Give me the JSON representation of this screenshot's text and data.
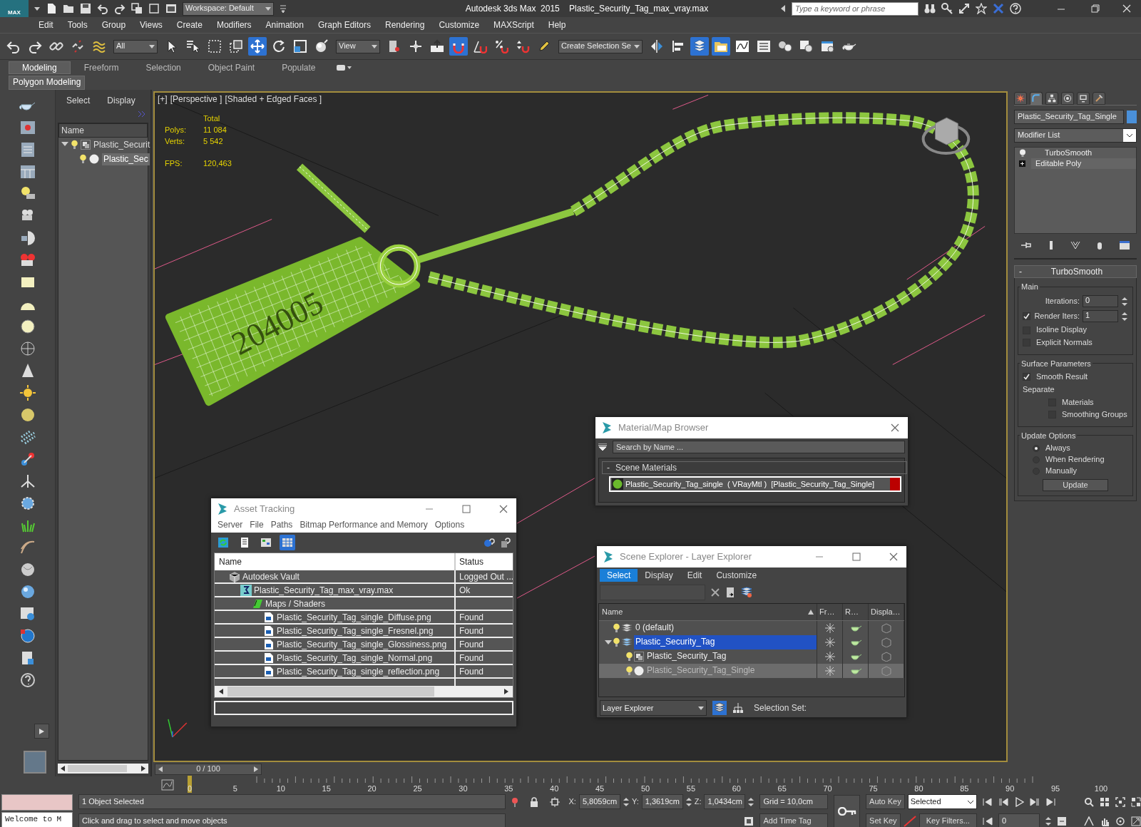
{
  "title_bar": {
    "logo": "MAX",
    "workspace": "Workspace: Default",
    "title": "Autodesk 3ds Max  2015    Plastic_Security_Tag_max_vray.max",
    "search": {
      "placeholder": "Type a keyword or phrase"
    }
  },
  "menu": [
    "Edit",
    "Tools",
    "Group",
    "Views",
    "Create",
    "Modifiers",
    "Animation",
    "Graph Editors",
    "Rendering",
    "Customize",
    "MAXScript",
    "Help"
  ],
  "main_toolbar": [
    {
      "kind": "undo",
      "selected": false
    },
    {
      "kind": "redo",
      "selected": false
    },
    {
      "kind": "link",
      "selected": false
    },
    {
      "kind": "unlink",
      "selected": false
    },
    {
      "kind": "bind",
      "selected": false
    },
    {
      "kind": "dropdown",
      "value": "All"
    },
    {
      "kind": "select",
      "selected": false
    },
    {
      "kind": "selname",
      "selected": false
    },
    {
      "kind": "region",
      "selected": false
    },
    {
      "kind": "crossing",
      "selected": false
    },
    {
      "kind": "move",
      "selected": true
    },
    {
      "kind": "rotate",
      "selected": false
    },
    {
      "kind": "scale",
      "selected": false
    },
    {
      "kind": "place",
      "selected": false
    },
    {
      "kind": "dropdown",
      "value": "View"
    },
    {
      "kind": "pivot",
      "selected": false
    },
    {
      "kind": "manip",
      "selected": false
    },
    {
      "kind": "kbd",
      "selected": false
    },
    {
      "kind": "snap",
      "selected": true
    },
    {
      "kind": "asnap",
      "selected": false
    },
    {
      "kind": "psnap",
      "selected": false
    },
    {
      "kind": "ssnap",
      "selected": false
    },
    {
      "kind": "pencil",
      "selected": false
    },
    {
      "kind": "dropdown",
      "value": "Create Selection Se"
    },
    {
      "kind": "mirror",
      "selected": false
    },
    {
      "kind": "align",
      "selected": false
    },
    {
      "kind": "layers",
      "selected": true
    },
    {
      "kind": "explorer",
      "selected": true
    },
    {
      "kind": "curves",
      "selected": false
    },
    {
      "kind": "schematic",
      "selected": false
    },
    {
      "kind": "mtl",
      "selected": false
    },
    {
      "kind": "rsetup",
      "selected": false
    },
    {
      "kind": "rframe",
      "selected": false
    },
    {
      "kind": "render",
      "selected": false
    }
  ],
  "ribbon": {
    "tabs": [
      {
        "label": "Modeling",
        "selected": true
      },
      {
        "label": "Freeform",
        "selected": false
      },
      {
        "label": "Selection",
        "selected": false
      },
      {
        "label": "Object Paint",
        "selected": false
      },
      {
        "label": "Populate",
        "selected": false
      }
    ],
    "panel": "Polygon Modeling"
  },
  "scene_panel": {
    "tabs": [
      "Select",
      "Display"
    ],
    "column": "Name",
    "tree": [
      {
        "kind": "group",
        "name": "Plastic_Securit",
        "selected": false,
        "expanded": true,
        "children": [
          {
            "kind": "object",
            "name": "Plastic_Sec",
            "selected": true
          }
        ]
      }
    ]
  },
  "viewport": {
    "labels": [
      "[+]",
      "[Perspective ]",
      "[Shaded + Edged Faces ]"
    ],
    "stats": {
      "header": "Total",
      "rows": [
        {
          "label": "Polys:",
          "value": "11 084"
        },
        {
          "label": "Verts:",
          "value": "5 542"
        },
        {
          "label": "FPS:",
          "value": "120,463"
        }
      ]
    },
    "model_text": "204005"
  },
  "command_panel": {
    "tabs": [
      {
        "kind": "create",
        "selected": false
      },
      {
        "kind": "modify",
        "selected": true
      },
      {
        "kind": "hierarchy",
        "selected": false
      },
      {
        "kind": "motion",
        "selected": false
      },
      {
        "kind": "display",
        "selected": false
      },
      {
        "kind": "utilities",
        "selected": false
      }
    ],
    "object_name": "Plastic_Security_Tag_Single",
    "modifier_list": "Modifier List",
    "stack": [
      {
        "kind": "modifier",
        "name": "TurboSmooth"
      },
      {
        "kind": "base",
        "name": "Editable Poly"
      }
    ],
    "rollout": {
      "toggle": "-",
      "title": "TurboSmooth",
      "groups": [
        {
          "title": "Main",
          "items": [
            {
              "kind": "spinner",
              "label": "Iterations:",
              "value": "0"
            },
            {
              "kind": "spinner",
              "label": "Render Iters:",
              "value": "1",
              "checked": true
            },
            {
              "kind": "checkbox",
              "label": "Isoline Display",
              "checked": false
            },
            {
              "kind": "checkbox",
              "label": "Explicit Normals",
              "checked": false
            }
          ]
        },
        {
          "title": "Surface Parameters",
          "items": [
            {
              "kind": "checkbox",
              "label": "Smooth Result",
              "checked": true
            },
            {
              "kind": "label",
              "label": "Separate",
              "children": [
                {
                  "kind": "checkbox",
                  "label": "Materials",
                  "checked": false
                },
                {
                  "kind": "checkbox",
                  "label": "Smoothing Groups",
                  "checked": false
                }
              ]
            }
          ]
        },
        {
          "title": "Update Options",
          "items": [
            {
              "kind": "radio",
              "label": "Always",
              "selected": true
            },
            {
              "kind": "radio",
              "label": "When Rendering",
              "selected": false
            },
            {
              "kind": "radio",
              "label": "Manually",
              "selected": false
            },
            {
              "kind": "button",
              "label": "Update"
            }
          ]
        }
      ]
    }
  },
  "material_browser": {
    "title": "Material/Map Browser",
    "search": {
      "placeholder": "Search by Name ..."
    },
    "group": {
      "toggle": "-",
      "title": "Scene Materials",
      "items": [
        {
          "name": "Plastic_Security_Tag_single  ( VRayMtl )  [Plastic_Security_Tag_Single]",
          "selected": true
        }
      ]
    }
  },
  "asset_tracking": {
    "title": "Asset Tracking",
    "menu": [
      "Server",
      "File",
      "Paths",
      "Bitmap Performance and Memory",
      "Options"
    ],
    "tools": [
      {
        "kind": "refresh",
        "selected": false
      },
      {
        "kind": "list",
        "selected": false
      },
      {
        "kind": "thumbs",
        "selected": false
      },
      {
        "kind": "table",
        "selected": true
      }
    ],
    "columns": [
      "Name",
      "Status"
    ],
    "rows": [
      {
        "kind": "vault",
        "name": "Autodesk Vault",
        "status": "Logged Out ...",
        "children": [
          {
            "kind": "max",
            "name": "Plastic_Security_Tag_max_vray.max",
            "status": "Ok",
            "children": [
              {
                "kind": "folder",
                "name": "Maps / Shaders",
                "children": [
                  {
                    "kind": "image",
                    "name": "Plastic_Security_Tag_single_Diffuse.png",
                    "status": "Found"
                  },
                  {
                    "kind": "image",
                    "name": "Plastic_Security_Tag_single_Fresnel.png",
                    "status": "Found"
                  },
                  {
                    "kind": "image",
                    "name": "Plastic_Security_Tag_single_Glossiness.png",
                    "status": "Found"
                  },
                  {
                    "kind": "image",
                    "name": "Plastic_Security_Tag_single_Normal.png",
                    "status": "Found"
                  },
                  {
                    "kind": "image",
                    "name": "Plastic_Security_Tag_single_reflection.png",
                    "status": "Found"
                  }
                ]
              }
            ]
          }
        ]
      }
    ]
  },
  "layer_explorer": {
    "title": "Scene Explorer - Layer Explorer",
    "tabs": [
      {
        "label": "Select",
        "selected": true
      },
      {
        "label": "Display",
        "selected": false
      },
      {
        "label": "Edit",
        "selected": false
      },
      {
        "label": "Customize",
        "selected": false
      }
    ],
    "columns": [
      "Name",
      "Fr…",
      "R…",
      "Displa…"
    ],
    "rows": [
      {
        "kind": "layer",
        "name": "0 (default)",
        "selected": false,
        "highlighted": false
      },
      {
        "kind": "layer",
        "name": "Plastic_Security_Tag",
        "selected": true,
        "highlighted": false,
        "expanded": true,
        "children": [
          {
            "kind": "group",
            "name": "Plastic_Security_Tag",
            "selected": false,
            "highlighted": false
          },
          {
            "kind": "object",
            "name": "Plastic_Security_Tag_Single",
            "selected": false,
            "highlighted": true
          }
        ]
      }
    ],
    "footer": {
      "mode": "Layer Explorer",
      "selection_set": "Selection Set:"
    }
  },
  "time_slider": {
    "value": "0 / 100"
  },
  "track_bar": {
    "ticks": [
      "0",
      "5",
      "10",
      "15",
      "20",
      "25",
      "30",
      "35",
      "40",
      "45",
      "50",
      "55",
      "60",
      "65",
      "70",
      "75",
      "80",
      "85",
      "90",
      "95",
      "100"
    ]
  },
  "status_bar": {
    "listener": "Welcome to M",
    "selection": "1 Object Selected",
    "prompt": "Click and drag to select and move objects",
    "coords": [
      {
        "label": "X:",
        "value": "5,8059cm"
      },
      {
        "label": "Y:",
        "value": "1,3619cm"
      },
      {
        "label": "Z:",
        "value": "1,0434cm"
      }
    ],
    "grid": "Grid = 10,0cm",
    "add_time_tag": "Add Time Tag",
    "auto_key": "Auto Key",
    "set_key": "Set Key",
    "key_mode": "Selected",
    "key_filters": "Key Filters...",
    "frame": "0"
  }
}
